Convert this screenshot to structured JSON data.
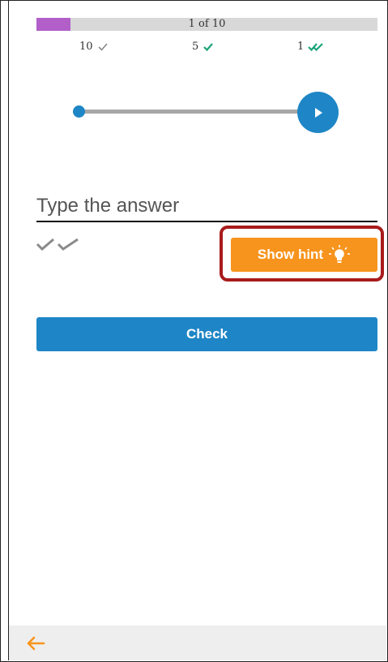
{
  "progress": {
    "label": "1 of 10",
    "current": 1,
    "total": 10,
    "fill_color": "#b25fc9"
  },
  "stats": [
    {
      "value": "10",
      "icon": "check-icon-grey",
      "color": "#8a8a8a"
    },
    {
      "value": "5",
      "icon": "check-icon-green",
      "color": "#1aa37a"
    },
    {
      "value": "1",
      "icon": "double-check-icon-green",
      "color": "#1aa37a"
    }
  ],
  "audio": {
    "position_fraction": 0.0,
    "play_icon": "play-icon",
    "color": "#1e86c6"
  },
  "answer": {
    "placeholder": "Type the answer",
    "value": ""
  },
  "attempt_icons": "double-check-icon-grey",
  "hint_button": {
    "label": "Show hint",
    "icon": "lightbulb-icon",
    "color": "#f7941d"
  },
  "check_button": {
    "label": "Check",
    "color": "#1e86c6"
  },
  "footer": {
    "back_icon": "arrow-left-icon",
    "color": "#f7941d"
  }
}
